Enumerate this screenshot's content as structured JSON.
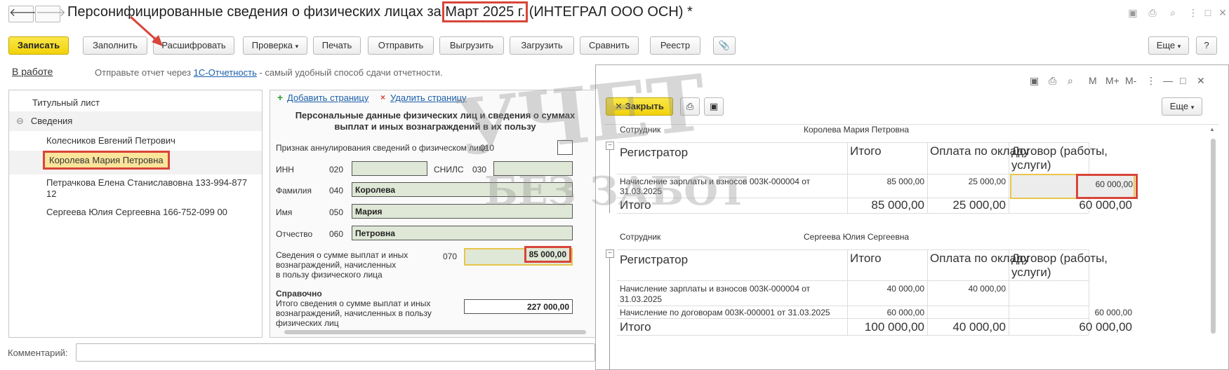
{
  "window": {
    "title_prefix": "Персонифицированные сведения о физических лицах за ",
    "title_period": "Март 2025 г.",
    "title_suffix": " (ИНТЕГРАЛ ООО ОСН) *",
    "back_icon": "arrow-left-icon",
    "forward_icon": "arrow-right-icon"
  },
  "toolbar": {
    "save": "Записать",
    "fill": "Заполнить",
    "decode": "Расшифровать",
    "check": "Проверка",
    "print": "Печать",
    "send": "Отправить",
    "upload": "Выгрузить",
    "load": "Загрузить",
    "compare": "Сравнить",
    "registry": "Реестр",
    "more": "Еще",
    "help": "?"
  },
  "status": {
    "state": "В работе",
    "text_before": "Отправьте отчет через ",
    "link": "1С-Отчетность",
    "text_after": " - самый удобный способ сдачи отчетности."
  },
  "tree": {
    "items": [
      {
        "label": "Титульный лист"
      },
      {
        "label": "Сведения",
        "toggle": "⊖"
      },
      {
        "label": "Колесников Евгений Петрович"
      },
      {
        "label": "Королева Мария Петровна"
      },
      {
        "label": "Петрачкова Елена Станиславовна 133-994-877"
      },
      {
        "label": "12"
      },
      {
        "label": "Сергеева Юлия Сергеевна 166-752-099 00"
      }
    ]
  },
  "form": {
    "add_page": "Добавить страницу",
    "delete_page": "Удалить страницу",
    "heading_line1": "Персональные данные физических лиц и сведения о суммах",
    "heading_line2": "выплат и иных вознаграждений в их пользу",
    "cancel_label": "Признак аннулирования сведений о физическом лице",
    "cancel_code": "010",
    "inn_label": "ИНН",
    "inn_code": "020",
    "snils_label": "СНИЛС",
    "snils_code": "030",
    "surname_label": "Фамилия",
    "surname_code": "040",
    "surname_value": "Королева",
    "name_label": "Имя",
    "name_code": "050",
    "name_value": "Мария",
    "patronymic_label": "Отчество",
    "patronymic_code": "060",
    "patronymic_value": "Петровна",
    "sum_label_1": "Сведения о сумме выплат и иных",
    "sum_label_2": "вознаграждений, начисленных",
    "sum_label_3": "в пользу физического лица",
    "sum_code": "070",
    "sum_value": "85 000,00",
    "ref_title": "Справочно",
    "ref_label_1": "Итого сведения о сумме выплат и иных",
    "ref_label_2": "вознаграждений, начисленных в пользу",
    "ref_label_3": "физических лиц",
    "ref_value": "227 000,00"
  },
  "report": {
    "close": "Закрыть",
    "more": "Еще",
    "title_icons": [
      "M",
      "M+",
      "M-"
    ],
    "employee_label": "Сотрудник",
    "columns": [
      "Регистратор",
      "Итого",
      "Оплата по окладу",
      "Договор (работы,",
      "услуги)"
    ],
    "total_label": "Итого",
    "block1": {
      "employee": "Королева Мария Петровна",
      "row1_reg_1": "Начисление зарплаты и взносов 003К-000004 от",
      "row1_reg_2": "31.03.2025",
      "row1_total": "85 000,00",
      "row1_salary": "25 000,00",
      "row1_contract": "60 000,00",
      "total_total": "85 000,00",
      "total_salary": "25 000,00",
      "total_contract": "60 000,00"
    },
    "block2": {
      "employee": "Сергеева Юлия Сергеевна",
      "row1_reg_1": "Начисление зарплаты и взносов 003К-000004 от",
      "row1_reg_2": "31.03.2025",
      "row1_total": "40 000,00",
      "row1_salary": "40 000,00",
      "row2_reg": "Начисление по договорам 003К-000001 от 31.03.2025",
      "row2_total": "60 000,00",
      "row2_contract": "60 000,00",
      "total_total": "100 000,00",
      "total_salary": "40 000,00",
      "total_contract": "60 000,00"
    }
  },
  "comment": {
    "label": "Комментарий:",
    "value": ""
  },
  "watermark": {
    "line1": "УЧЕТ",
    "line2": "БЕЗ ЗАБОТ"
  },
  "colors": {
    "accent_yellow": "#f2d20a",
    "highlight_red": "#d8453a",
    "field_green": "#dfe8d6",
    "link_blue": "#1b5fab"
  }
}
